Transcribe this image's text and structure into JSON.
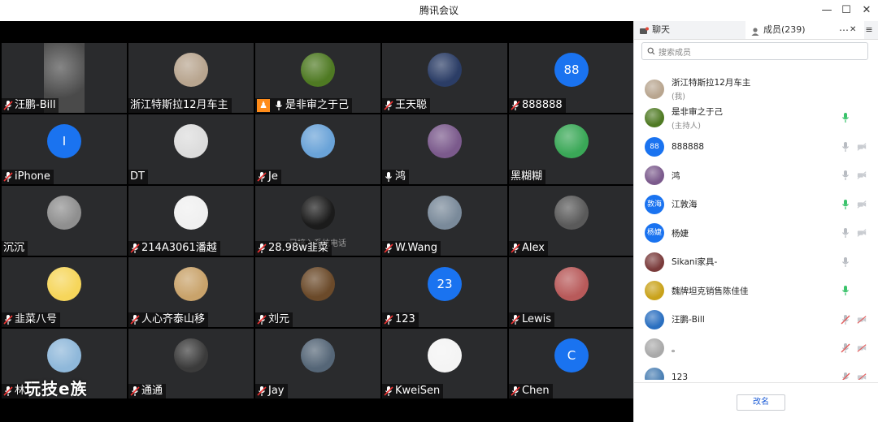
{
  "window": {
    "title": "腾讯会议",
    "minimize": "—",
    "maximize": "☐",
    "close": "✕"
  },
  "tiles": [
    {
      "name": "汪鹏-Bill",
      "mic": "muted",
      "avatar": "photo",
      "color": "#4a4a4a"
    },
    {
      "name": "浙江特斯拉12月车主",
      "mic": "none",
      "avatar": "photo",
      "color": "#b8a58f"
    },
    {
      "name": "是非审之于己",
      "mic": "on",
      "host": true,
      "avatar": "photo",
      "color": "#4f7a23"
    },
    {
      "name": "王天聪",
      "mic": "muted",
      "avatar": "photo",
      "color": "#2b3d66"
    },
    {
      "name": "888888",
      "mic": "muted",
      "avatar": "letter",
      "letter": "88"
    },
    {
      "name": "iPhone",
      "mic": "muted",
      "avatar": "letter",
      "letter": "I"
    },
    {
      "name": "DT",
      "mic": "none",
      "avatar": "photo",
      "color": "#dcdcdc"
    },
    {
      "name": "Je",
      "mic": "muted",
      "avatar": "photo",
      "color": "#6aa3d8"
    },
    {
      "name": "鸿",
      "mic": "on",
      "avatar": "photo",
      "color": "#7b5a8c"
    },
    {
      "name": "黑糊糊",
      "mic": "none",
      "avatar": "photo",
      "color": "#3aa857"
    },
    {
      "name": "沉沉",
      "mic": "none",
      "avatar": "photo",
      "color": "#8f8f8f"
    },
    {
      "name": "214A3061潘越",
      "mic": "muted",
      "avatar": "photo",
      "color": "#f0f0f0"
    },
    {
      "name": "28.98w韭菜",
      "mic": "muted",
      "avatar": "photo",
      "color": "#1b1b1b",
      "note": "已接入系统电话"
    },
    {
      "name": "W.Wang",
      "mic": "muted",
      "avatar": "photo",
      "color": "#7a8a9a"
    },
    {
      "name": "Alex",
      "mic": "muted",
      "avatar": "photo",
      "color": "#5a5a5a"
    },
    {
      "name": "韭菜八号",
      "mic": "muted",
      "avatar": "photo",
      "color": "#f6d65b"
    },
    {
      "name": "人心齐泰山移",
      "mic": "muted",
      "avatar": "photo",
      "color": "#c9a36b"
    },
    {
      "name": "刘元",
      "mic": "muted",
      "avatar": "photo",
      "color": "#6b4a2a"
    },
    {
      "name": "123",
      "mic": "muted",
      "avatar": "letter",
      "letter": "23"
    },
    {
      "name": "Lewis",
      "mic": "muted",
      "avatar": "photo",
      "color": "#b85a5a"
    },
    {
      "name": "林",
      "mic": "muted",
      "avatar": "photo",
      "color": "#8fb8da"
    },
    {
      "name": "通通",
      "mic": "muted",
      "avatar": "photo",
      "color": "#3b3b3b"
    },
    {
      "name": "Jay",
      "mic": "muted",
      "avatar": "photo",
      "color": "#556677"
    },
    {
      "name": "KweiSen",
      "mic": "muted",
      "avatar": "photo",
      "color": "#f4f4f4"
    },
    {
      "name": "Chen",
      "mic": "muted",
      "avatar": "letter",
      "letter": "C"
    }
  ],
  "watermark": "玩技e族",
  "panel": {
    "chat_tab": "聊天",
    "members_tab": "成员(239)",
    "more": "⋯",
    "close": "✕",
    "menu": "≡",
    "search_placeholder": "搜索成员",
    "rename": "改名",
    "members": [
      {
        "name": "浙江特斯拉12月车主",
        "sub": "(我)",
        "avatar": "photo",
        "color": "#b8a58f",
        "mic": "none",
        "cam": "none"
      },
      {
        "name": "是非审之于己",
        "sub": "(主持人)",
        "avatar": "photo",
        "color": "#4f7a23",
        "mic": "on",
        "cam": "none"
      },
      {
        "name": "888888",
        "avatar": "letter",
        "letter": "88",
        "mic": "off",
        "cam": "off"
      },
      {
        "name": "鸿",
        "avatar": "photo",
        "color": "#7b5a8c",
        "mic": "off",
        "cam": "off"
      },
      {
        "name": "江敦海",
        "avatar": "letter",
        "letter": "敦海",
        "mic": "on",
        "cam": "off"
      },
      {
        "name": "杨婕",
        "avatar": "letter",
        "letter": "杨婕",
        "mic": "off",
        "cam": "off"
      },
      {
        "name": "Sikani家具-",
        "avatar": "photo",
        "color": "#7a3b3b",
        "mic": "off",
        "cam": "none"
      },
      {
        "name": "魏牌坦克销售陈佳佳",
        "avatar": "photo",
        "color": "#c9a21a",
        "mic": "on",
        "cam": "none"
      },
      {
        "name": "汪鹏-Bill",
        "avatar": "photo",
        "color": "#2a6fc0",
        "mic": "muted",
        "cam": "muted"
      },
      {
        "name": "。",
        "avatar": "photo",
        "color": "#a9a9a9",
        "mic": "muted",
        "cam": "muted"
      },
      {
        "name": "123",
        "avatar": "photo",
        "color": "#4a7fb3",
        "mic": "muted",
        "cam": "muted"
      }
    ]
  }
}
